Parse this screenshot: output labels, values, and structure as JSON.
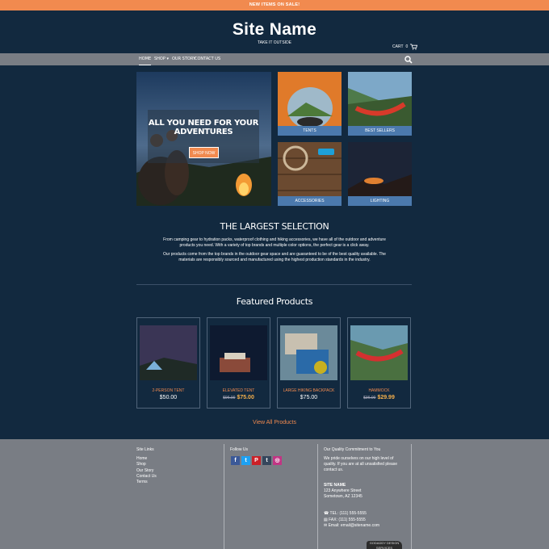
{
  "promo_bar": "NEW ITEMS ON SALE!",
  "site": {
    "name": "Site Name",
    "tagline": "TAKE IT OUTSIDE"
  },
  "cart": {
    "label": "CART",
    "count": "0"
  },
  "nav": {
    "home": "HOME",
    "shop": "SHOP ▾",
    "story": "OUR STORY",
    "contact": "CONTACT US"
  },
  "hero": {
    "title": "ALL YOU NEED FOR YOUR ADVENTURES",
    "button": "SHOP NOW"
  },
  "categories": [
    "TENTS",
    "BEST SELLERS",
    "ACCESSORIES",
    "LIGHTING"
  ],
  "selection": {
    "title": "THE LARGEST SELECTION",
    "p1": "From camping gear to hydration packs, waterproof clothing and hiking accessories, we have all of the outdoor and adventure products you need. With a variety of top brands and multiple color options, the perfect gear is a click away.",
    "p2": "Our products come from the top brands in the outdoor gear space and are guaranteed to be of the best quality available. The materials are responsibly sourced and manufactured using the highest production standards in the industry."
  },
  "featured": {
    "title": "Featured Products",
    "products": [
      {
        "name": "2-PERSON TENT",
        "price": "$50.00",
        "old": "",
        "sale": ""
      },
      {
        "name": "ELEVATED TENT",
        "price": "",
        "old": "$96.00",
        "sale": "$75.00"
      },
      {
        "name": "LARGE HIKING BACKPACK",
        "price": "$75.00",
        "old": "",
        "sale": ""
      },
      {
        "name": "HAMMOCK",
        "price": "",
        "old": "$36.00",
        "sale": "$29.99"
      }
    ],
    "view_all": "View All Products"
  },
  "footer": {
    "links_title": "Site Links",
    "links": [
      "Home",
      "Shop",
      "Our Story",
      "Contact Us",
      "Terms"
    ],
    "follow_title": "Follow Us",
    "social": [
      "f",
      "t",
      "P",
      "t",
      "◎"
    ],
    "commit_title": "Our Quality Commitment to You",
    "commit_text": "We pride ourselves on our high level of quality. If you are at all unsatisfied please contact us.",
    "company": "SITE NAME",
    "address1": "123 Anywhere Street",
    "address2": "Sometown, AZ 12345",
    "tel": "TEL: (111) 555-5555",
    "fax": "FAX: (111) 555-5555",
    "email": "Email: email@sitename.com",
    "badge": "GODADDY DESIGN SERVICES"
  },
  "colors": {
    "background": "#12293f",
    "accent": "#f18a4f",
    "nav": "#797d84",
    "label": "#4b79ad"
  }
}
